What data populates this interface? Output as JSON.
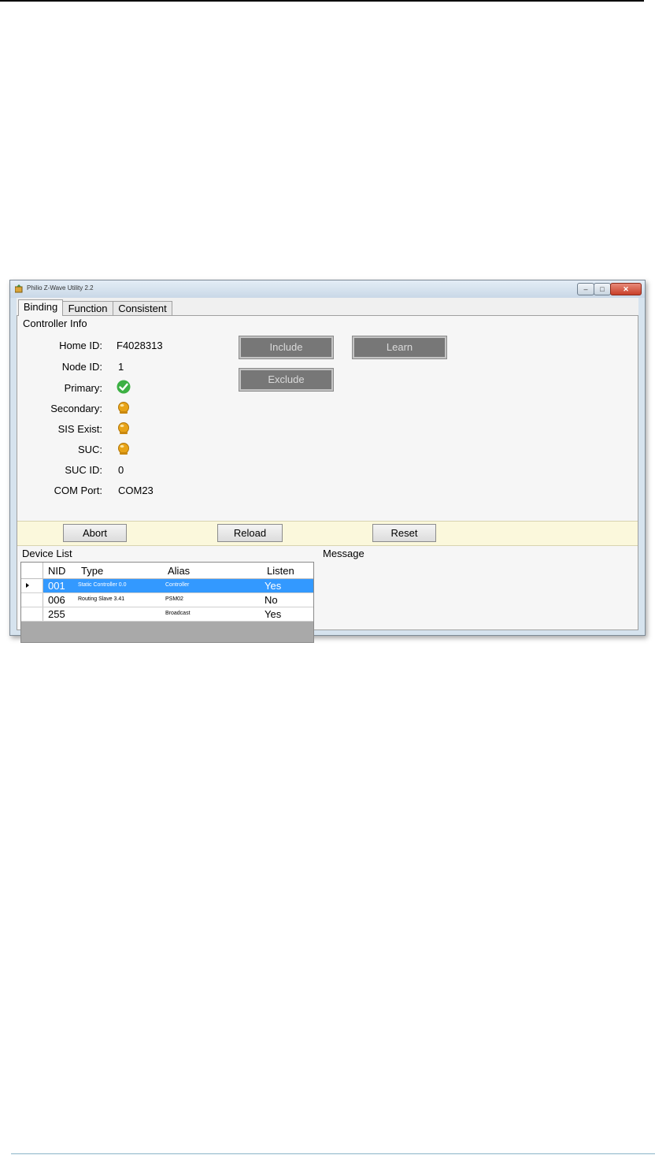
{
  "window": {
    "title": "Philio Z-Wave Utility 2.2",
    "minimize_label": "–",
    "maximize_label": "□",
    "close_label": "✕"
  },
  "tabs": [
    {
      "label": "Binding",
      "active": true
    },
    {
      "label": "Function",
      "active": false
    },
    {
      "label": "Consistent",
      "active": false
    }
  ],
  "controller_info": {
    "heading": "Controller Info",
    "home_id_label": "Home ID:",
    "home_id_value": "F4028313",
    "node_id_label": "Node ID:",
    "node_id_value": "1",
    "primary_label": "Primary:",
    "primary_status": "check-icon",
    "secondary_label": "Secondary:",
    "secondary_status": "warning-bulb-icon",
    "sis_exist_label": "SIS Exist:",
    "sis_exist_status": "warning-bulb-icon",
    "suc_label": "SUC:",
    "suc_status": "warning-bulb-icon",
    "suc_id_label": "SUC ID:",
    "suc_id_value": "0",
    "com_port_label": "COM Port:",
    "com_port_value": "COM23"
  },
  "actions": {
    "include_label": "Include",
    "learn_label": "Learn",
    "exclude_label": "Exclude"
  },
  "toolbar": {
    "abort_label": "Abort",
    "reload_label": "Reload",
    "reset_label": "Reset"
  },
  "device_list": {
    "heading": "Device List",
    "columns": [
      "NID",
      "Type",
      "Alias",
      "Listen"
    ],
    "rows": [
      {
        "nid": "001",
        "type": "Static Controller  0.0",
        "alias": "Controller",
        "listen": "Yes",
        "selected": true
      },
      {
        "nid": "006",
        "type": "Routing Slave  3.41",
        "alias": "PSM02",
        "listen": "No",
        "selected": false
      },
      {
        "nid": "255",
        "type": "",
        "alias": "Broadcast",
        "listen": "Yes",
        "selected": false
      }
    ]
  },
  "message": {
    "heading": "Message"
  },
  "colors": {
    "selection": "#3399ff",
    "ok_green": "#3cb043",
    "warning_orange": "#e8a317",
    "toolbar_bg": "#fbf8dc"
  }
}
